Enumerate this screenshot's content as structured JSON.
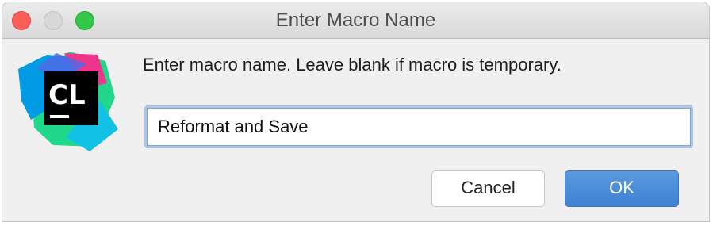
{
  "window": {
    "title": "Enter Macro Name"
  },
  "dialog": {
    "message": "Enter macro name. Leave blank if macro is temporary.",
    "macro_name_value": "Reformat and Save",
    "cancel_label": "Cancel",
    "ok_label": "OK"
  },
  "logo": {
    "text": "CL",
    "icon": "clion-logo-icon",
    "colors": [
      "#21D789",
      "#009AE5",
      "#ED358C",
      "#000000"
    ]
  },
  "colors": {
    "primary_button": "#4A8BDB",
    "focus_ring": "#A9C7EC",
    "close": "#FC5F57",
    "maximize": "#34C84A"
  }
}
